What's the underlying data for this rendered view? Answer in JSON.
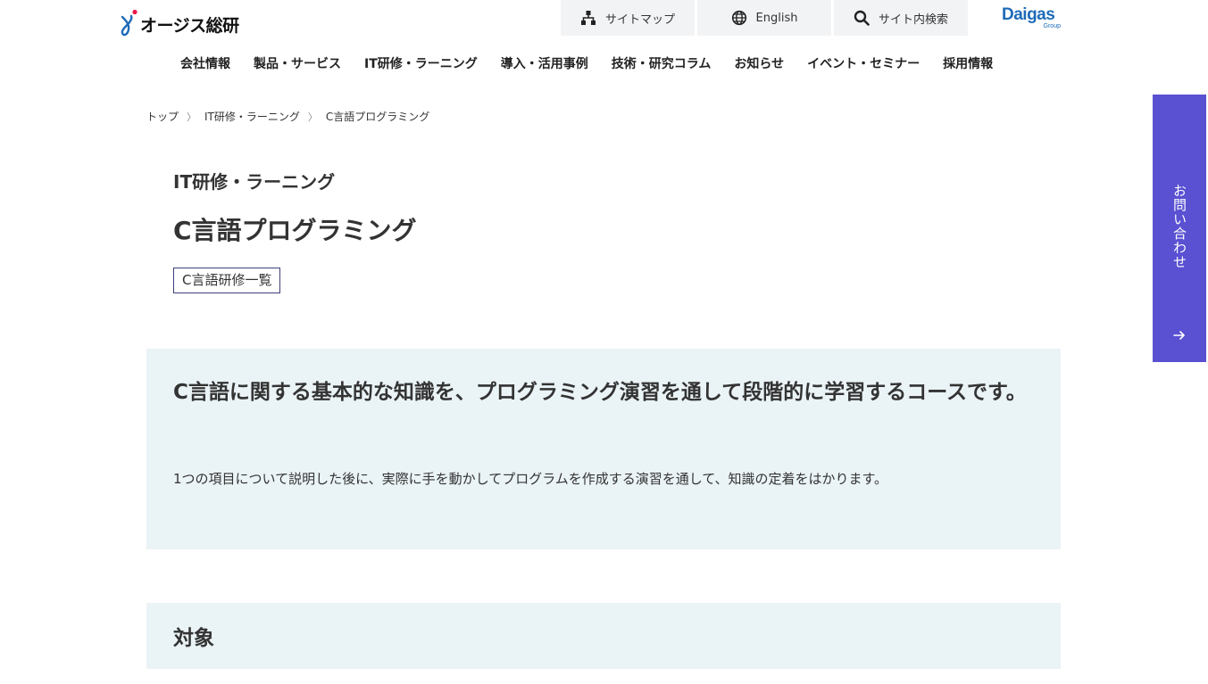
{
  "header": {
    "logo_text": "オージス総研",
    "util": {
      "sitemap": "サイトマップ",
      "english": "English",
      "search": "サイト内検索"
    },
    "group_logo": {
      "name": "Daigas",
      "sub": "Group"
    }
  },
  "nav": {
    "items": [
      {
        "label": "会社情報"
      },
      {
        "label": "製品・サービス"
      },
      {
        "label": "IT研修・ラーニング"
      },
      {
        "label": "導入・活用事例"
      },
      {
        "label": "技術・研究コラム"
      },
      {
        "label": "お知らせ"
      },
      {
        "label": "イベント・セミナー"
      },
      {
        "label": "採用情報"
      }
    ]
  },
  "breadcrumb": {
    "items": [
      {
        "label": "トップ"
      },
      {
        "label": "IT研修・ラーニング"
      },
      {
        "label": "C言語プログラミング"
      }
    ],
    "separator": "〉"
  },
  "page": {
    "category": "IT研修・ラーニング",
    "title": "C言語プログラミング",
    "tag_button": "C言語研修一覧"
  },
  "intro": {
    "heading": "C言語に関する基本的な知識を、プログラミング演習を通して段階的に学習するコースです。",
    "body": "1つの項目について説明した後に、実際に手を動かしてプログラムを作成する演習を通して、知識の定着をはかります。"
  },
  "target": {
    "heading": "対象"
  },
  "contact": {
    "label": "お問い合わせ",
    "color": "#5a50d2"
  },
  "colors": {
    "brand_blue": "#1e6bb8",
    "logo_red": "#e8194b",
    "panel_bg": "#eaf3f6",
    "util_bg": "#f2f3f5"
  },
  "icons": {
    "sitemap": "sitemap-icon",
    "english": "globe-icon",
    "search": "search-icon",
    "contact_arrow": "arrow-right-icon"
  }
}
